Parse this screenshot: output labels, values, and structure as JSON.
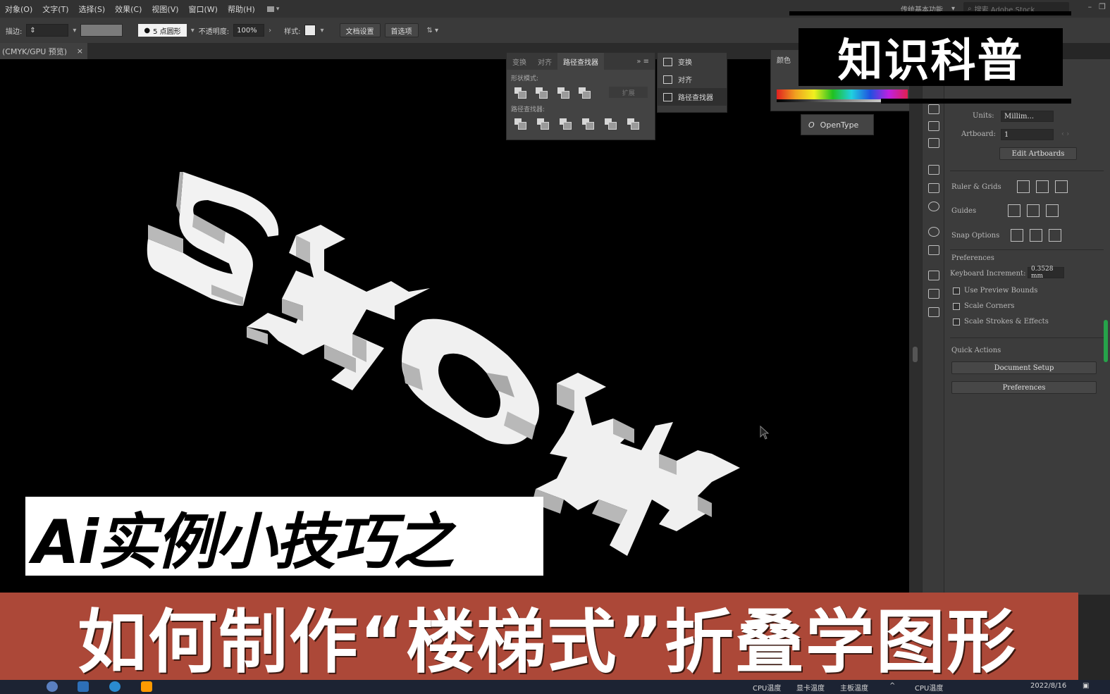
{
  "menubar": {
    "items": [
      "对象(O)",
      "文字(T)",
      "选择(S)",
      "效果(C)",
      "视图(V)",
      "窗口(W)",
      "帮助(H)"
    ],
    "workspace": "传统基本功能",
    "search_placeholder": "搜索 Adobe Stock"
  },
  "controlbar": {
    "stroke_label": "描边:",
    "brush": "5 点圆形",
    "opacity_label": "不透明度:",
    "opacity_value": "100%",
    "style_label": "样式:",
    "doc_setup": "文档设置",
    "preferences": "首选项"
  },
  "doc_tab": {
    "title": "(CMYK/GPU 预览)",
    "close": "×"
  },
  "artwork": {
    "text": "SHOW"
  },
  "pathfinder_panel": {
    "tabs": [
      "变换",
      "对齐",
      "路径查找器"
    ],
    "shape_modes_label": "形状模式:",
    "pathfinders_label": "路径查找器:",
    "expand_label": "扩展"
  },
  "mini_dock": {
    "items": [
      "变换",
      "对齐",
      "路径查找器"
    ]
  },
  "color_panel": {
    "title": "颜色"
  },
  "opentype": {
    "label": "OpenType"
  },
  "properties": {
    "units_label": "Units:",
    "units_value": "Millim...",
    "artboard_label": "Artboard:",
    "artboard_value": "1",
    "edit_artboards": "Edit Artboards",
    "ruler_grids": "Ruler & Grids",
    "guides": "Guides",
    "snap_options": "Snap Options",
    "preferences_header": "Preferences",
    "keyboard_increment_label": "Keyboard Increment:",
    "keyboard_increment_value": "0.3528 mm",
    "checkboxes": [
      "Use Preview Bounds",
      "Scale Corners",
      "Scale Strokes & Effects"
    ],
    "quick_actions": "Quick Actions",
    "document_setup": "Document Setup",
    "preferences_button": "Preferences"
  },
  "overlay": {
    "badge": "知识科普",
    "subtitle": "Ai实例小技巧之",
    "banner": "如何制作“楼梯式”折叠学图形"
  },
  "taskbar": {
    "cpu_temp": "CPU温度",
    "gpu_temp": "显卡温度",
    "board_temp": "主板温度",
    "cpu_temp2": "CPU温度",
    "date": "2022/8/16"
  }
}
